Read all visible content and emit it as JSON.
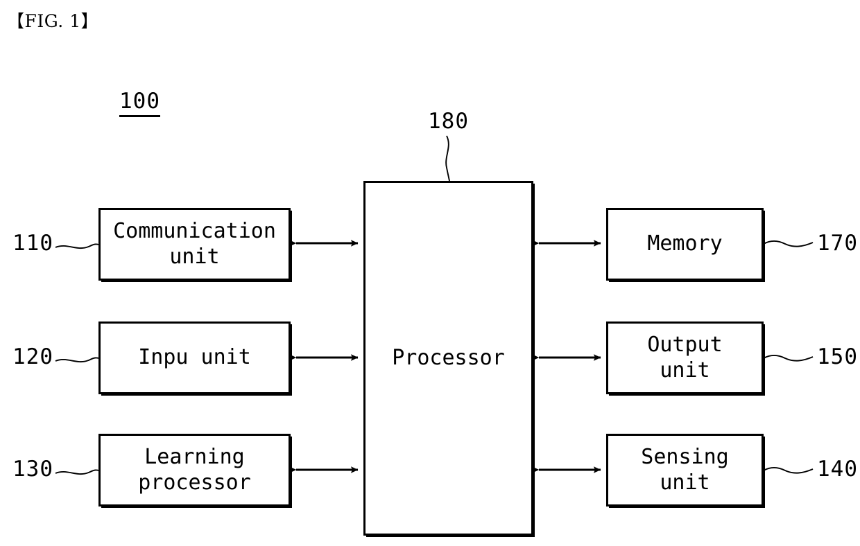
{
  "figure": {
    "title": "【FIG. 1】",
    "system_ref": "100"
  },
  "blocks": {
    "communication": {
      "label": "Communication\nunit",
      "ref": "110"
    },
    "input": {
      "label": "Inpu unit",
      "ref": "120"
    },
    "learning": {
      "label": "Learning\nprocessor",
      "ref": "130"
    },
    "processor": {
      "label": "Processor",
      "ref": "180"
    },
    "memory": {
      "label": "Memory",
      "ref": "170"
    },
    "output": {
      "label": "Output\nunit",
      "ref": "150"
    },
    "sensing": {
      "label": "Sensing\nunit",
      "ref": "140"
    }
  },
  "connections": [
    {
      "name": "communication-processor",
      "type": "bidirectional-arrow"
    },
    {
      "name": "input-processor",
      "type": "bidirectional-arrow"
    },
    {
      "name": "learning-processor",
      "type": "bidirectional-arrow"
    },
    {
      "name": "processor-memory",
      "type": "bidirectional-arrow"
    },
    {
      "name": "processor-output",
      "type": "bidirectional-arrow"
    },
    {
      "name": "processor-sensing",
      "type": "bidirectional-arrow"
    }
  ],
  "colors": {
    "stroke": "#000000",
    "background": "#ffffff"
  }
}
